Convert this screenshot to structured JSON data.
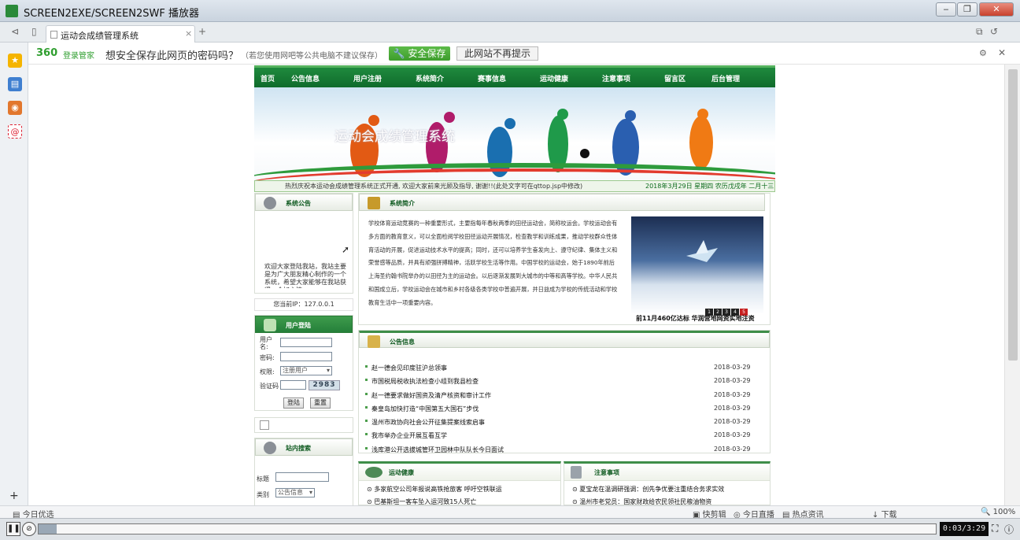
{
  "window": {
    "title": "SCREEN2EXE/SCREEN2SWF 播放器"
  },
  "browser": {
    "tab_title": "运动会成绩管理系统",
    "tab_close": "×",
    "new_tab": "+",
    "pwbar": {
      "logo": "360",
      "logo_sub": "登录管家",
      "question": "想安全保存此网页的密码吗？",
      "note": "（若您使用网吧等公共电脑不建议保存）",
      "save": "安全保存",
      "never": "此网站不再提示"
    },
    "sidebar_add": "+",
    "status": {
      "left": "今日优选",
      "items": [
        "快剪辑",
        "今日直播",
        "热点资讯",
        "下载"
      ],
      "zoom": "100%"
    }
  },
  "site": {
    "nav": [
      "首页",
      "公告信息",
      "用户注册",
      "系统简介",
      "赛事信息",
      "运动健康",
      "注意事项",
      "留言区",
      "后台管理"
    ],
    "banner_title": "运动会成绩管理系统",
    "ticker": "热烈庆祝本运动会成绩管理系统正式开通, 欢迎大家前来光顾及指导, 谢谢!!(此处文字可在qttop.jsp中修改)",
    "ticker_date": "2018年3月29日 星期四 农历戊戌年 二月十三",
    "notice": {
      "title": "系统公告",
      "body": "欢迎大家登陆我站，我站主要是为广大朋友精心制作的一个系统，希望大家能够在我站获得一个好心情，"
    },
    "ip": "您当前IP：127.0.0.1",
    "login": {
      "title": "用户登陆",
      "user_label": "用户名:",
      "pass_label": "密码:",
      "role_label": "权限:",
      "role_value": "注册用户",
      "code_label": "验证码",
      "captcha": "2983",
      "login_btn": "登陆",
      "reset_btn": "重置"
    },
    "search": {
      "title": "站内搜索",
      "title_label": "标题",
      "type_label": "类别",
      "type_value": "公告信息"
    },
    "intro": {
      "title": "系统简介",
      "text": "学校体育运动竞赛的一种重要形式，主要指每年春秋两季的田径运动会，简称校运会。学校运动会有多方面的教育意义，可以全面检阅学校田径运动开展情况，检查教学和训练成果，推动学校群众性体育活动的开展，促进运动技术水平的提高；同时，还可以培养学生奋发向上、遵守纪律、集体主义和荣誉感等品质，并具有顽强拼搏精神，活跃学校生活等作用。中国学校的运动会，始于1890年前后上海圣约翰书院举办的以田径为主的运动会。以后逐渐发展到大城市的中等和高等学校。中华人民共和国成立后，学校运动会在城市和乡村各级各类学校中普遍开展，并日益成为学校的传统活动和学校教育生活中一项重要内容。",
      "photo_controls": [
        "1",
        "2",
        "3",
        "4",
        "5"
      ],
      "caption": "前11月460亿达标 华润营地网资实地注资"
    },
    "news": {
      "title": "公告信息",
      "rows": [
        {
          "title": "赵一德会见印度驻沪总领事",
          "date": "2018-03-29"
        },
        {
          "title": "市国税局税收执法检查小组到我县检查",
          "date": "2018-03-29"
        },
        {
          "title": "赵一德要求做好国资及清产核资和审计工作",
          "date": "2018-03-29"
        },
        {
          "title": "秦皇岛加快打造“中国第五大国石”步伐",
          "date": "2018-03-29"
        },
        {
          "title": "温州市政协向社会公开征集提案线索启事",
          "date": "2018-03-29"
        },
        {
          "title": "我市举办企业开展互看互学",
          "date": "2018-03-29"
        },
        {
          "title": "浅库港公开选拔城管环卫园林中队队长今日面试",
          "date": "2018-03-29"
        }
      ]
    },
    "health": {
      "title": "运动健康",
      "rows": [
        "多家航空公司年报说高铁抢旅客 呼吁空铁联运",
        "巴基斯坦一客车坠入运河致15人死亡"
      ]
    },
    "notes": {
      "title": "注意事项",
      "rows": [
        "夏宝龙在温调研强调：创先争优要注重结合务求实效",
        "温州市老党员：国家财政给农民领社民粮油物资"
      ]
    }
  },
  "player": {
    "play": "❚❚",
    "time": "0:03/3:29",
    "progress": 0.02
  }
}
